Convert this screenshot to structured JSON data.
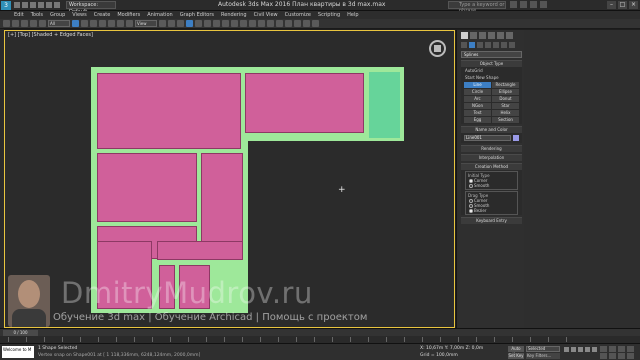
{
  "titlebar": {
    "logo": "3",
    "workspace": "Workspace: Default",
    "title": "Autodesk 3ds Max 2016     План квартиры в 3d max.max",
    "search_placeholder": "Type a keyword or phrase"
  },
  "menu": [
    "Edit",
    "Tools",
    "Group",
    "Views",
    "Create",
    "Modifiers",
    "Animation",
    "Graph Editors",
    "Rendering",
    "Civil View",
    "Customize",
    "Scripting",
    "Help"
  ],
  "toolbar": {
    "selection_filter": "All",
    "view_dropdown": "View"
  },
  "viewport": {
    "label": "[+] [Top] [Shaded + Edged Faces]",
    "colors": {
      "wall": "#9ee89a",
      "room": "#d0609a",
      "balcony": "#66d49a",
      "border": "#e9c53f"
    }
  },
  "watermark": {
    "main": "DmitryMudrov.ru",
    "sub": "Обучение 3d max | Обучение Archicad | Помощь с проектом"
  },
  "panel": {
    "object_category": "Splines",
    "object_type_title": "Object Type",
    "autogrid": "AutoGrid",
    "start_new_shape": "Start New Shape",
    "buttons": [
      "Line",
      "Rectangle",
      "Circle",
      "Ellipse",
      "Arc",
      "Donut",
      "NGon",
      "Star",
      "Text",
      "Helix",
      "Egg",
      "Section"
    ],
    "name_color_title": "Name and Color",
    "object_name": "Line001",
    "rendering": "Rendering",
    "interpolation": "Interpolation",
    "creation_method": "Creation Method",
    "initial_type": "Initial Type",
    "initial_corner": "Corner",
    "initial_smooth": "Smooth",
    "drag_type": "Drag Type",
    "drag_corner": "Corner",
    "drag_smooth": "Smooth",
    "drag_bezier": "Bezier",
    "keyboard_entry": "Keyboard Entry"
  },
  "timeline": {
    "slider": "0 / 100"
  },
  "status": {
    "listener": "Welcome to M",
    "selected": "1 Shape Selected",
    "hint": "Vertex snap on Shape001 at [ 1 118,336mm, 6248,124mm, 2000,0mm]",
    "coords": "X: 10,67m  Y: 7,00m  Z: 0,0m",
    "grid": "Grid = 100,0mm",
    "add_time_tag": "Add Time Tag",
    "autokey": "Auto Key",
    "selected_dd": "Selected",
    "setkey": "Set Key",
    "key_filters": "Key Filters..."
  }
}
